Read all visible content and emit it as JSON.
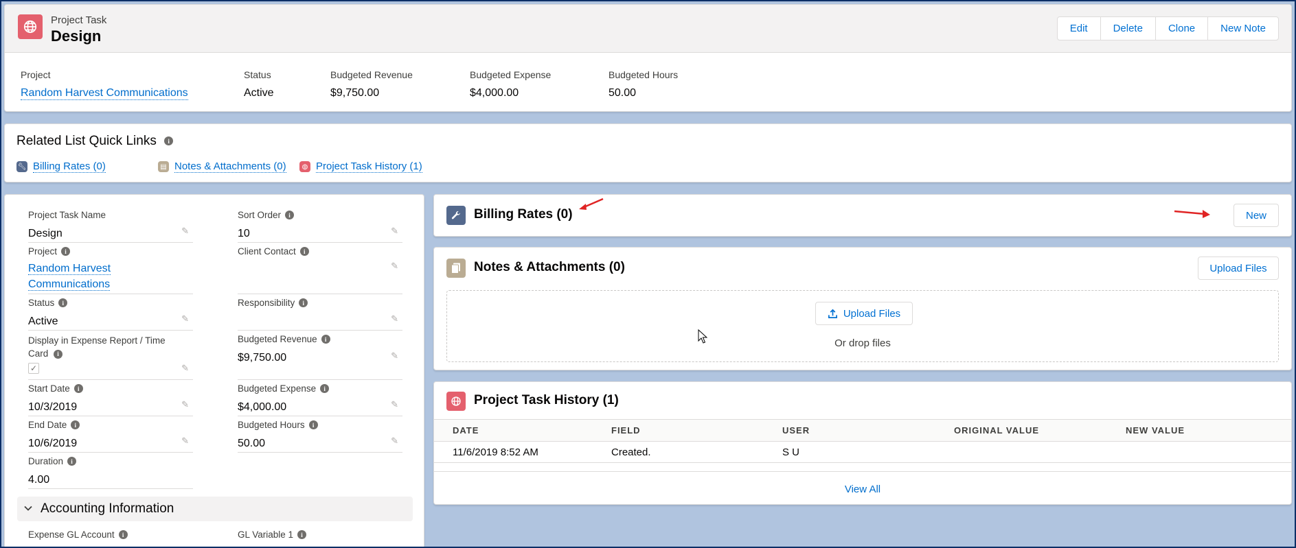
{
  "header": {
    "object_type": "Project Task",
    "title": "Design",
    "actions": [
      "Edit",
      "Delete",
      "Clone",
      "New Note"
    ],
    "highlights": [
      {
        "label": "Project",
        "value": "Random Harvest Communications",
        "link": true
      },
      {
        "label": "Status",
        "value": "Active",
        "link": false
      },
      {
        "label": "Budgeted Revenue",
        "value": "$9,750.00",
        "link": false
      },
      {
        "label": "Budgeted Expense",
        "value": "$4,000.00",
        "link": false
      },
      {
        "label": "Budgeted Hours",
        "value": "50.00",
        "link": false
      }
    ]
  },
  "quick_links": {
    "title": "Related List Quick Links",
    "items": [
      {
        "label": "Billing Rates (0)",
        "icon": "wrench-icon",
        "color": "#54698d"
      },
      {
        "label": "Notes & Attachments (0)",
        "icon": "note-icon",
        "color": "#baac93"
      },
      {
        "label": "Project Task History (1)",
        "icon": "globe-icon",
        "color": "#e4606d"
      }
    ]
  },
  "details": {
    "fields": {
      "task_name": {
        "label": "Project Task Name",
        "value": "Design"
      },
      "sort_order": {
        "label": "Sort Order",
        "value": "10"
      },
      "project": {
        "label": "Project",
        "value_line1": "Random Harvest",
        "value_line2": "Communications"
      },
      "client_contact": {
        "label": "Client Contact",
        "value": ""
      },
      "status": {
        "label": "Status",
        "value": "Active"
      },
      "responsibility": {
        "label": "Responsibility",
        "value": ""
      },
      "display_expense": {
        "label_line1": "Display in Expense Report / Time",
        "label_line2": "Card",
        "checked": true
      },
      "budgeted_revenue": {
        "label": "Budgeted Revenue",
        "value": "$9,750.00"
      },
      "start_date": {
        "label": "Start Date",
        "value": "10/3/2019"
      },
      "budgeted_expense": {
        "label": "Budgeted Expense",
        "value": "$4,000.00"
      },
      "end_date": {
        "label": "End Date",
        "value": "10/6/2019"
      },
      "budgeted_hours": {
        "label": "Budgeted Hours",
        "value": "50.00"
      },
      "duration": {
        "label": "Duration",
        "value": "4.00"
      },
      "expense_gl": {
        "label": "Expense GL Account"
      },
      "gl_variable_1": {
        "label": "GL Variable 1"
      }
    },
    "section_title": "Accounting Information"
  },
  "billing": {
    "title": "Billing Rates (0)",
    "new_label": "New",
    "icon": "wrench-icon",
    "color": "#54698d"
  },
  "notes": {
    "title": "Notes & Attachments (0)",
    "upload_label": "Upload Files",
    "drop_upload_label": "Upload Files",
    "drop_text": "Or drop files",
    "icon": "note-icon",
    "color": "#baac93"
  },
  "history": {
    "title": "Project Task History (1)",
    "icon": "globe-icon",
    "color": "#e4606d",
    "columns": [
      "DATE",
      "FIELD",
      "USER",
      "ORIGINAL VALUE",
      "NEW VALUE"
    ],
    "rows": [
      {
        "date": "11/6/2019 8:52 AM",
        "field": "Created.",
        "user": "S U",
        "original": "",
        "new": ""
      }
    ],
    "view_all": "View All"
  }
}
